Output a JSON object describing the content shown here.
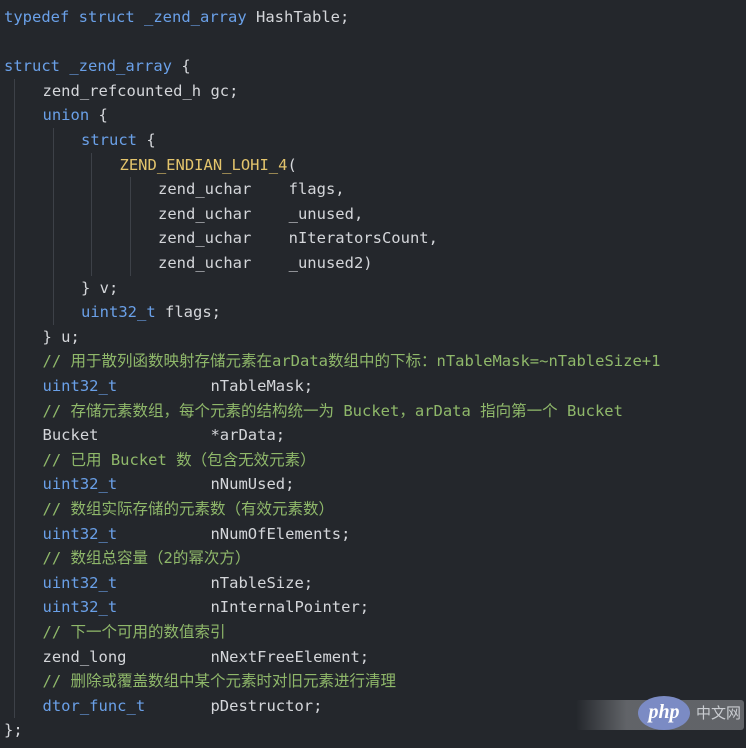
{
  "colors": {
    "background": "#24272c",
    "keyword": "#6aa0e8",
    "type": "#6aa0e8",
    "identifier": "#d4d6da",
    "macro": "#e3c46c",
    "comment": "#8fb86a",
    "indent_guide": "#3d4148"
  },
  "code": {
    "lines": [
      {
        "indent": 0,
        "tokens": [
          {
            "t": "typedef",
            "k": "keyword"
          },
          {
            "t": " ",
            "k": "identifier"
          },
          {
            "t": "struct",
            "k": "keyword"
          },
          {
            "t": " _zend_array ",
            "k": "keyword"
          },
          {
            "t": "HashTable;",
            "k": "identifier"
          }
        ]
      },
      {
        "indent": 0,
        "tokens": []
      },
      {
        "indent": 0,
        "tokens": [
          {
            "t": "struct",
            "k": "keyword"
          },
          {
            "t": " _zend_array ",
            "k": "keyword"
          },
          {
            "t": "{",
            "k": "identifier"
          }
        ]
      },
      {
        "indent": 1,
        "tokens": [
          {
            "t": "zend_refcounted_h gc;",
            "k": "identifier"
          }
        ]
      },
      {
        "indent": 1,
        "tokens": [
          {
            "t": "union",
            "k": "keyword"
          },
          {
            "t": " {",
            "k": "identifier"
          }
        ]
      },
      {
        "indent": 2,
        "tokens": [
          {
            "t": "struct",
            "k": "keyword"
          },
          {
            "t": " {",
            "k": "identifier"
          }
        ]
      },
      {
        "indent": 3,
        "tokens": [
          {
            "t": "ZEND_ENDIAN_LOHI_4",
            "k": "macro"
          },
          {
            "t": "(",
            "k": "identifier"
          }
        ]
      },
      {
        "indent": 4,
        "tokens": [
          {
            "t": "zend_uchar    flags,",
            "k": "identifier"
          }
        ]
      },
      {
        "indent": 4,
        "tokens": [
          {
            "t": "zend_uchar    _unused,",
            "k": "identifier"
          }
        ]
      },
      {
        "indent": 4,
        "tokens": [
          {
            "t": "zend_uchar    nIteratorsCount,",
            "k": "identifier"
          }
        ]
      },
      {
        "indent": 4,
        "tokens": [
          {
            "t": "zend_uchar    _unused2)",
            "k": "identifier"
          }
        ]
      },
      {
        "indent": 2,
        "tokens": [
          {
            "t": "} v;",
            "k": "identifier"
          }
        ]
      },
      {
        "indent": 2,
        "tokens": [
          {
            "t": "uint32_t",
            "k": "type"
          },
          {
            "t": " flags;",
            "k": "identifier"
          }
        ]
      },
      {
        "indent": 1,
        "tokens": [
          {
            "t": "} u;",
            "k": "identifier"
          }
        ]
      },
      {
        "indent": 1,
        "tokens": [
          {
            "t": "// 用于散列函数映射存储元素在arData数组中的下标：nTableMask=~nTableSize+1",
            "k": "comment"
          }
        ]
      },
      {
        "indent": 1,
        "tokens": [
          {
            "t": "uint32_t",
            "k": "type"
          },
          {
            "t": "          nTableMask;",
            "k": "identifier"
          }
        ]
      },
      {
        "indent": 1,
        "tokens": [
          {
            "t": "// 存储元素数组，每个元素的结构统一为 Bucket，arData 指向第一个 Bucket",
            "k": "comment"
          }
        ]
      },
      {
        "indent": 1,
        "tokens": [
          {
            "t": "Bucket            *arData;",
            "k": "identifier"
          }
        ]
      },
      {
        "indent": 1,
        "tokens": [
          {
            "t": "// 已用 Bucket 数（包含无效元素）",
            "k": "comment"
          }
        ]
      },
      {
        "indent": 1,
        "tokens": [
          {
            "t": "uint32_t",
            "k": "type"
          },
          {
            "t": "          nNumUsed;",
            "k": "identifier"
          }
        ]
      },
      {
        "indent": 1,
        "tokens": [
          {
            "t": "// 数组实际存储的元素数（有效元素数）",
            "k": "comment"
          }
        ]
      },
      {
        "indent": 1,
        "tokens": [
          {
            "t": "uint32_t",
            "k": "type"
          },
          {
            "t": "          nNumOfElements;",
            "k": "identifier"
          }
        ]
      },
      {
        "indent": 1,
        "tokens": [
          {
            "t": "// 数组总容量（2的幂次方）",
            "k": "comment"
          }
        ]
      },
      {
        "indent": 1,
        "tokens": [
          {
            "t": "uint32_t",
            "k": "type"
          },
          {
            "t": "          nTableSize;",
            "k": "identifier"
          }
        ]
      },
      {
        "indent": 1,
        "tokens": [
          {
            "t": "uint32_t",
            "k": "type"
          },
          {
            "t": "          nInternalPointer;",
            "k": "identifier"
          }
        ]
      },
      {
        "indent": 1,
        "tokens": [
          {
            "t": "// 下一个可用的数值索引",
            "k": "comment"
          }
        ]
      },
      {
        "indent": 1,
        "tokens": [
          {
            "t": "zend_long",
            "k": "identifier"
          },
          {
            "t": "         nNextFreeElement;",
            "k": "identifier"
          }
        ]
      },
      {
        "indent": 1,
        "tokens": [
          {
            "t": "// 删除或覆盖数组中某个元素时对旧元素进行清理",
            "k": "comment"
          }
        ]
      },
      {
        "indent": 1,
        "tokens": [
          {
            "t": "dtor_func_t",
            "k": "type"
          },
          {
            "t": "       pDestructor;",
            "k": "identifier"
          }
        ]
      },
      {
        "indent": 0,
        "tokens": [
          {
            "t": "};",
            "k": "identifier"
          }
        ]
      }
    ]
  },
  "watermark": {
    "logo_text": "php",
    "site_text": "中文网"
  }
}
